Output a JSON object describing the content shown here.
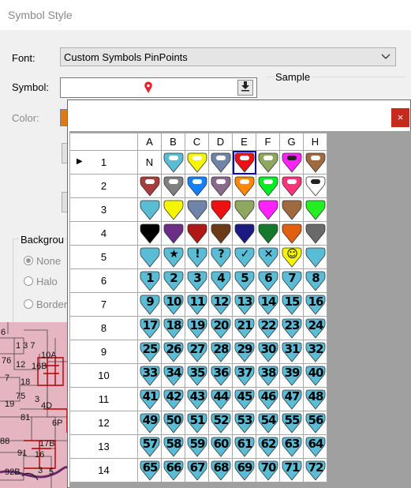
{
  "dialog": {
    "title": "Symbol Style",
    "font_label": "Font:",
    "font_value": "Custom Symbols PinPoints",
    "symbol_label": "Symbol:",
    "sample_label": "Sample",
    "color_label": "Color:",
    "background_label": "Backgrou",
    "radios": [
      "None",
      "Halo",
      "Border"
    ],
    "symbol_color": "#e8202a"
  },
  "map": {
    "labels": [
      "6",
      "1 3 7",
      "76",
      "12",
      "16B",
      "10A",
      "7",
      "18",
      "75",
      "3",
      "19",
      "4D",
      "81",
      "6P",
      "88",
      "91",
      "17B",
      "16",
      "92B",
      "3",
      "5"
    ]
  },
  "picker": {
    "close_glyph": "×",
    "columns": [
      "A",
      "B",
      "C",
      "D",
      "E",
      "F",
      "G",
      "H"
    ],
    "rows": [
      {
        "label": "1",
        "cells": [
          {
            "t": "N"
          },
          {
            "c": "#5bbcd6",
            "d": "#ffffff"
          },
          {
            "c": "#f5f500",
            "d": "#ffffff"
          },
          {
            "c": "#6f84a8",
            "d": "#ffffff"
          },
          {
            "c": "#ee1111",
            "d": "#ffffff"
          },
          {
            "c": "#8fa85f",
            "d": "#ffffff"
          },
          {
            "c": "#ff22ff",
            "d": "#222222"
          },
          {
            "c": "#a06a40",
            "d": "#ffffff"
          }
        ]
      },
      {
        "label": "2",
        "cells": [
          {
            "c": "#a83c3c",
            "d": "#ffffff"
          },
          {
            "c": "#808080",
            "d": "#ffffff"
          },
          {
            "c": "#1580ff",
            "d": "#ffffff"
          },
          {
            "c": "#8a6a8a",
            "d": "#ffffff"
          },
          {
            "c": "#ff8800",
            "d": "#ffffff"
          },
          {
            "c": "#00ee22",
            "d": "#ffffff"
          },
          {
            "c": "#ff3377",
            "d": "#ffffff"
          },
          {
            "c": "#ffffff",
            "d": "#222222"
          }
        ]
      },
      {
        "label": "3",
        "cells": [
          {
            "c": "#5bbcd6"
          },
          {
            "c": "#f5f500"
          },
          {
            "c": "#6f84a8"
          },
          {
            "c": "#ee1111"
          },
          {
            "c": "#8fa85f"
          },
          {
            "c": "#ff22ff"
          },
          {
            "c": "#a06a40"
          },
          {
            "c": "#22ee22"
          }
        ]
      },
      {
        "label": "4",
        "cells": [
          {
            "c": "#000000"
          },
          {
            "c": "#6b2d86"
          },
          {
            "c": "#b01818"
          },
          {
            "c": "#6b3b18"
          },
          {
            "c": "#1a1a80"
          },
          {
            "c": "#127a2a"
          },
          {
            "c": "#e06010"
          },
          {
            "c": "#6a6a6a"
          }
        ]
      },
      {
        "label": "5",
        "cells": [
          {
            "c": "#5bbcd6",
            "s": ""
          },
          {
            "c": "#5bbcd6",
            "s": "★"
          },
          {
            "c": "#5bbcd6",
            "s": "!"
          },
          {
            "c": "#5bbcd6",
            "s": "?"
          },
          {
            "c": "#5bbcd6",
            "s": "✓"
          },
          {
            "c": "#5bbcd6",
            "s": "✕"
          },
          {
            "c": "#f5f500",
            "s": "☺"
          },
          {
            "c": "#5bbcd6",
            "s": ""
          }
        ]
      },
      {
        "label": "6",
        "cells": [
          {
            "n": "1"
          },
          {
            "n": "2"
          },
          {
            "n": "3"
          },
          {
            "n": "4"
          },
          {
            "n": "5"
          },
          {
            "n": "6"
          },
          {
            "n": "7"
          },
          {
            "n": "8"
          }
        ]
      },
      {
        "label": "7",
        "cells": [
          {
            "n": "9"
          },
          {
            "n": "10"
          },
          {
            "n": "11"
          },
          {
            "n": "12"
          },
          {
            "n": "13"
          },
          {
            "n": "14"
          },
          {
            "n": "15"
          },
          {
            "n": "16"
          }
        ]
      },
      {
        "label": "8",
        "cells": [
          {
            "n": "17"
          },
          {
            "n": "18"
          },
          {
            "n": "19"
          },
          {
            "n": "20"
          },
          {
            "n": "21"
          },
          {
            "n": "22"
          },
          {
            "n": "23"
          },
          {
            "n": "24"
          }
        ]
      },
      {
        "label": "9",
        "cells": [
          {
            "n": "25"
          },
          {
            "n": "26"
          },
          {
            "n": "27"
          },
          {
            "n": "28"
          },
          {
            "n": "29"
          },
          {
            "n": "30"
          },
          {
            "n": "31"
          },
          {
            "n": "32"
          }
        ]
      },
      {
        "label": "10",
        "cells": [
          {
            "n": "33"
          },
          {
            "n": "34"
          },
          {
            "n": "35"
          },
          {
            "n": "36"
          },
          {
            "n": "37"
          },
          {
            "n": "38"
          },
          {
            "n": "39"
          },
          {
            "n": "40"
          }
        ]
      },
      {
        "label": "11",
        "cells": [
          {
            "n": "41"
          },
          {
            "n": "42"
          },
          {
            "n": "43"
          },
          {
            "n": "44"
          },
          {
            "n": "45"
          },
          {
            "n": "46"
          },
          {
            "n": "47"
          },
          {
            "n": "48"
          }
        ]
      },
      {
        "label": "12",
        "cells": [
          {
            "n": "49"
          },
          {
            "n": "50"
          },
          {
            "n": "51"
          },
          {
            "n": "52"
          },
          {
            "n": "53"
          },
          {
            "n": "54"
          },
          {
            "n": "55"
          },
          {
            "n": "56"
          }
        ]
      },
      {
        "label": "13",
        "cells": [
          {
            "n": "57"
          },
          {
            "n": "58"
          },
          {
            "n": "59"
          },
          {
            "n": "60"
          },
          {
            "n": "61"
          },
          {
            "n": "62"
          },
          {
            "n": "63"
          },
          {
            "n": "64"
          }
        ]
      },
      {
        "label": "14",
        "cells": [
          {
            "n": "65"
          },
          {
            "n": "66"
          },
          {
            "n": "67"
          },
          {
            "n": "68"
          },
          {
            "n": "69"
          },
          {
            "n": "70"
          },
          {
            "n": "71"
          },
          {
            "n": "72"
          }
        ]
      }
    ],
    "selected": {
      "row": 0,
      "col": 4
    },
    "current_row": 0,
    "number_pin_color": "#5bbcd6"
  }
}
